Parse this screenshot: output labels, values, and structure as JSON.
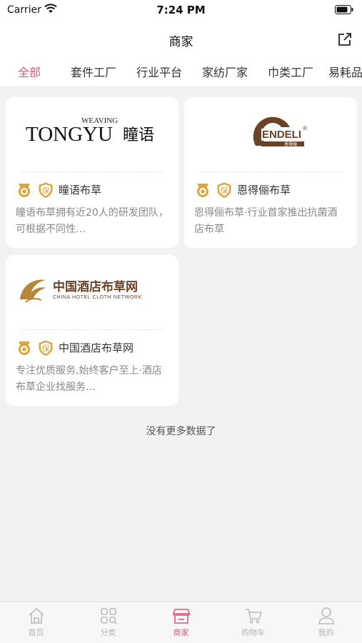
{
  "status_bar": {
    "carrier": "Carrier",
    "time": "7:24 PM"
  },
  "nav": {
    "title": "商家"
  },
  "tabs": [
    {
      "label": "全部",
      "active": true
    },
    {
      "label": "套件工厂"
    },
    {
      "label": "行业平台"
    },
    {
      "label": "家纺厂家"
    },
    {
      "label": "巾类工厂"
    },
    {
      "label": "易耗品"
    }
  ],
  "merchants": [
    {
      "logo_text": "TONGYU",
      "logo_sub": "WEAVING",
      "logo_cn": "瞳语",
      "name": "瞳语布草",
      "description": "瞳语布草拥有近20人的研发团队，可根据不同性…"
    },
    {
      "logo_text": "ENDELI",
      "logo_cn": "恩得俪",
      "name": "恩得俪布草",
      "description": "恩得俪布草·行业首家推出抗菌酒店布草"
    },
    {
      "logo_text": "中国酒店布草网",
      "logo_sub": "CHINA HOTEL CLOTH NETWORK",
      "name": "中国酒店布草网",
      "description": "专注优质服务,始终客户至上·酒店布草企业找服务…"
    }
  ],
  "badges": {
    "bao": "保"
  },
  "no_more_text": "没有更多数据了",
  "tabbar": [
    {
      "label": "首页",
      "icon": "home-icon"
    },
    {
      "label": "分类",
      "icon": "category-icon"
    },
    {
      "label": "商家",
      "icon": "store-icon",
      "active": true
    },
    {
      "label": "购物车",
      "icon": "cart-icon"
    },
    {
      "label": "我的",
      "icon": "profile-icon"
    }
  ],
  "colors": {
    "accent": "#e05577",
    "badge_gold": "#d9a63a",
    "logo_brown": "#6b4329",
    "logo_gold": "#b8863a"
  }
}
